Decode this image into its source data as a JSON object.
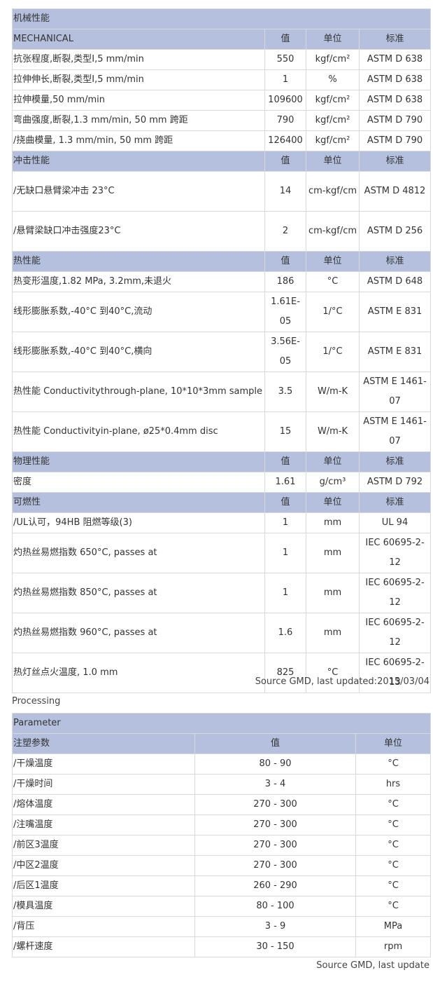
{
  "properties": {
    "title": "机械性能",
    "col_value": "值",
    "col_unit": "单位",
    "col_std": "标准",
    "sections": [
      {
        "name": "MECHANICAL",
        "rows": [
          {
            "prop": "抗张程度,断裂,类型I,5 mm/min",
            "value": "550",
            "unit": "kgf/cm²",
            "std": "ASTM D 638"
          },
          {
            "prop": "拉伸伸长,断裂,类型I,5 mm/min",
            "value": "1",
            "unit": "%",
            "std": "ASTM D 638"
          },
          {
            "prop": "拉伸模量,50 mm/min",
            "value": "109600",
            "unit": "kgf/cm²",
            "std": "ASTM D 638"
          },
          {
            "prop": "弯曲强度,断裂,1.3 mm/min, 50 mm 跨距",
            "value": "790",
            "unit": "kgf/cm²",
            "std": "ASTM D 790"
          },
          {
            "prop": "/挠曲模量, 1.3 mm/min, 50 mm 跨距",
            "value": "126400",
            "unit": "kgf/cm²",
            "std": "ASTM D 790"
          }
        ]
      },
      {
        "name": "冲击性能",
        "rows": [
          {
            "prop": "/无缺口悬臂梁冲击 23°C",
            "value": "14",
            "unit": "cm-kgf/cm",
            "std": "ASTM D 4812"
          },
          {
            "prop": "/悬臂梁缺口冲击强度23°C",
            "value": "2",
            "unit": "cm-kgf/cm",
            "std": "ASTM D 256"
          }
        ]
      },
      {
        "name": "热性能",
        "rows": [
          {
            "prop": "热变形温度,1.82 MPa, 3.2mm,未退火",
            "value": "186",
            "unit": "°C",
            "std": "ASTM D 648"
          },
          {
            "prop": "线形膨胀系数,-40°C 到40°C,流动",
            "value": "1.61E-05",
            "unit": "1/°C",
            "std": "ASTM E 831"
          },
          {
            "prop": "线形膨胀系数,-40°C 到40°C,横向",
            "value": "3.56E-05",
            "unit": "1/°C",
            "std": "ASTM E 831"
          },
          {
            "prop": "热性能 Conductivitythrough-plane, 10*10*3mm sample",
            "value": "3.5",
            "unit": "W/m-K",
            "std": "ASTM E 1461-07"
          },
          {
            "prop": "热性能 Conductivityin-plane, ø25*0.4mm disc",
            "value": "15",
            "unit": "W/m-K",
            "std": "ASTM E 1461-07"
          }
        ]
      },
      {
        "name": "物理性能",
        "rows": [
          {
            "prop": "密度",
            "value": "1.61",
            "unit": "g/cm³",
            "std": "ASTM D 792"
          }
        ]
      },
      {
        "name": "可燃性",
        "rows": [
          {
            "prop": "/UL认可，94HB 阻燃等级(3)",
            "value": "1",
            "unit": "mm",
            "std": "UL 94"
          },
          {
            "prop": "灼热丝易燃指数 650°C, passes at",
            "value": "1",
            "unit": "mm",
            "std": "IEC 60695-2-12"
          },
          {
            "prop": "灼热丝易燃指数 850°C, passes at",
            "value": "1",
            "unit": "mm",
            "std": "IEC 60695-2-12"
          },
          {
            "prop": "灼热丝易燃指数 960°C, passes at",
            "value": "1.6",
            "unit": "mm",
            "std": "IEC 60695-2-12"
          },
          {
            "prop": "热灯丝点火温度, 1.0 mm",
            "value": "825",
            "unit": "°C",
            "std": "IEC 60695-2-13"
          }
        ]
      }
    ],
    "source": "Source GMD, last updated:2015/03/04"
  },
  "processing": {
    "label": "Processing",
    "title": "Parameter",
    "header": {
      "param": "注塑参数",
      "value": "值",
      "unit": "单位"
    },
    "rows": [
      {
        "param": "/干燥温度",
        "value": "80 - 90",
        "unit": "°C"
      },
      {
        "param": "/干燥时间",
        "value": "3 - 4",
        "unit": "hrs"
      },
      {
        "param": "/熔体温度",
        "value": "270 - 300",
        "unit": "°C"
      },
      {
        "param": "/注嘴温度",
        "value": "270 - 300",
        "unit": "°C"
      },
      {
        "param": "/前区3温度",
        "value": "270 - 300",
        "unit": "°C"
      },
      {
        "param": "/中区2温度",
        "value": "270 - 300",
        "unit": "°C"
      },
      {
        "param": "/后区1温度",
        "value": "260 - 290",
        "unit": "°C"
      },
      {
        "param": "/模具温度",
        "value": "80 - 100",
        "unit": "°C"
      },
      {
        "param": "/背压",
        "value": "3 - 9",
        "unit": "MPa"
      },
      {
        "param": "/螺杆速度",
        "value": "30 - 150",
        "unit": "rpm"
      }
    ],
    "source": "Source GMD, last update"
  }
}
